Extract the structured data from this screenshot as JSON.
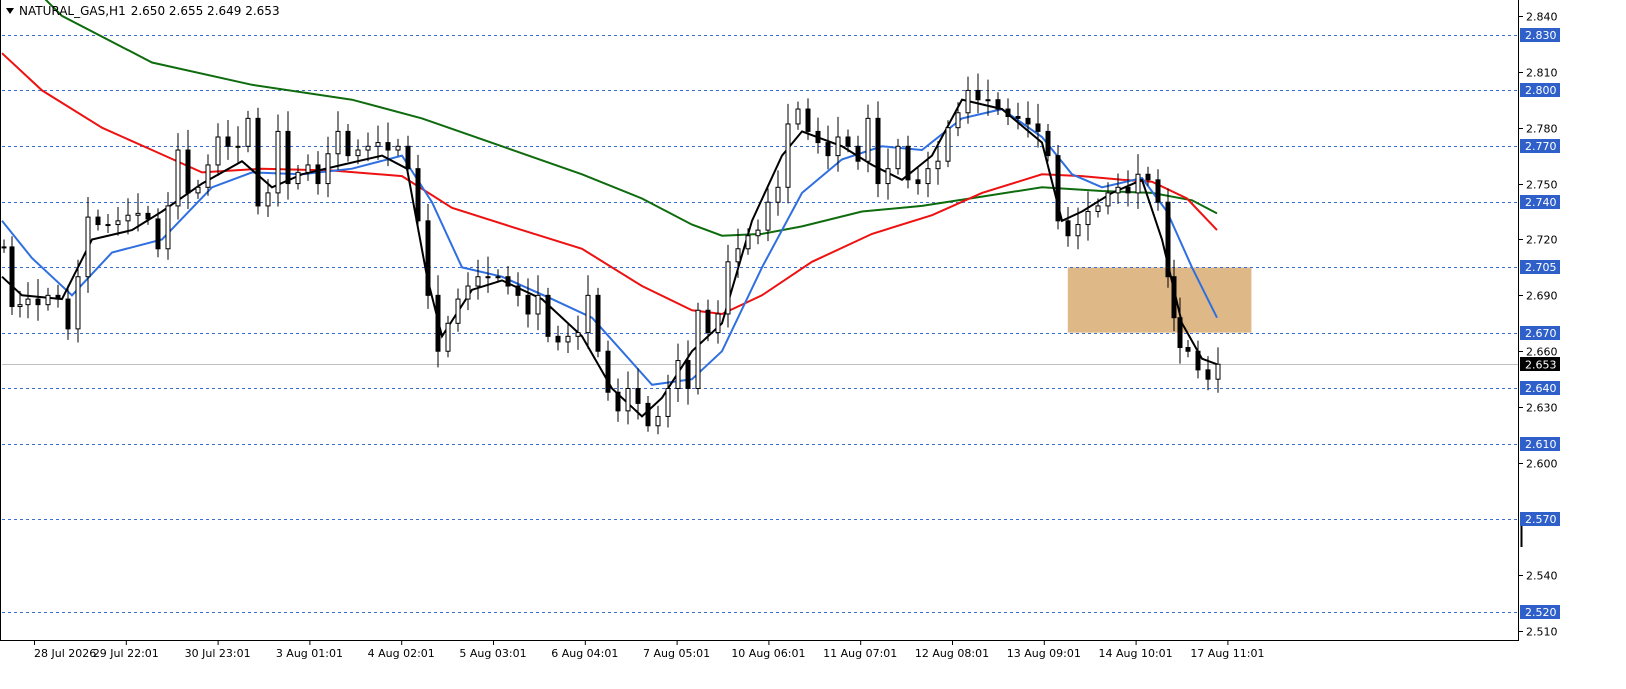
{
  "header": {
    "symbol": "NATURAL_GAS,H1",
    "ohlc": "2.650 2.655 2.649 2.653"
  },
  "colors": {
    "level_line": "#3a6fd1",
    "level_label_bg": "#2f60c9",
    "bull": "#000000",
    "ema_fast": "#000000",
    "ema_mid": "#2f6fe0",
    "ema_slow": "#ee1111",
    "ema_long": "#0e6b0e",
    "zone_fill": "#deb887",
    "current_bg": "#000000",
    "current_line": "#c0c0c0"
  },
  "chart_data": {
    "type": "candlestick",
    "ylim": [
      2.505,
      2.848
    ],
    "y_ticks": [
      "2.510",
      "2.540",
      "2.600",
      "2.630",
      "2.660",
      "2.690",
      "2.720",
      "2.750",
      "2.780",
      "2.810",
      "2.840"
    ],
    "horizontal_levels": [
      "2.520",
      "2.570",
      "2.610",
      "2.640",
      "2.670",
      "2.705",
      "2.740",
      "2.770",
      "2.800",
      "2.830"
    ],
    "current_price": "2.653",
    "x_labels": [
      "28 Jul 2026",
      "29 Jul 22:01",
      "30 Jul 23:01",
      "3 Aug 01:01",
      "4 Aug 02:01",
      "5 Aug 03:01",
      "6 Aug 04:01",
      "7 Aug 05:01",
      "10 Aug 06:01",
      "11 Aug 07:01",
      "12 Aug 08:01",
      "13 Aug 09:01",
      "14 Aug 10:01",
      "17 Aug 11:01"
    ],
    "zone": {
      "top": 2.705,
      "bottom": 2.67,
      "start_label": "13 Aug 09:01",
      "end_label": "17 Aug 11:01"
    },
    "price_path": [
      [
        0,
        2.716
      ],
      [
        8,
        2.684
      ],
      [
        16,
        2.685
      ],
      [
        24,
        2.688
      ],
      [
        34,
        2.685
      ],
      [
        44,
        2.69
      ],
      [
        54,
        2.688
      ],
      [
        64,
        2.672
      ],
      [
        74,
        2.7
      ],
      [
        84,
        2.732
      ],
      [
        94,
        2.728
      ],
      [
        104,
        2.728
      ],
      [
        114,
        2.73
      ],
      [
        124,
        2.733
      ],
      [
        134,
        2.734
      ],
      [
        144,
        2.731
      ],
      [
        154,
        2.715
      ],
      [
        164,
        2.738
      ],
      [
        174,
        2.768
      ],
      [
        184,
        2.745
      ],
      [
        194,
        2.748
      ],
      [
        204,
        2.76
      ],
      [
        214,
        2.775
      ],
      [
        224,
        2.77
      ],
      [
        234,
        2.77
      ],
      [
        244,
        2.785
      ],
      [
        254,
        2.738
      ],
      [
        264,
        2.745
      ],
      [
        274,
        2.778
      ],
      [
        284,
        2.75
      ],
      [
        294,
        2.756
      ],
      [
        304,
        2.76
      ],
      [
        314,
        2.75
      ],
      [
        324,
        2.766
      ],
      [
        334,
        2.778
      ],
      [
        344,
        2.765
      ],
      [
        354,
        2.768
      ],
      [
        364,
        2.77
      ],
      [
        374,
        2.772
      ],
      [
        384,
        2.768
      ],
      [
        394,
        2.77
      ],
      [
        404,
        2.758
      ],
      [
        414,
        2.73
      ],
      [
        424,
        2.69
      ],
      [
        434,
        2.66
      ],
      [
        444,
        2.675
      ],
      [
        454,
        2.688
      ],
      [
        464,
        2.695
      ],
      [
        474,
        2.7
      ],
      [
        484,
        2.7
      ],
      [
        494,
        2.7
      ],
      [
        504,
        2.695
      ],
      [
        514,
        2.69
      ],
      [
        524,
        2.68
      ],
      [
        534,
        2.69
      ],
      [
        544,
        2.668
      ],
      [
        554,
        2.665
      ],
      [
        564,
        2.668
      ],
      [
        574,
        2.67
      ],
      [
        584,
        2.69
      ],
      [
        594,
        2.66
      ],
      [
        604,
        2.638
      ],
      [
        614,
        2.628
      ],
      [
        624,
        2.64
      ],
      [
        634,
        2.632
      ],
      [
        644,
        2.62
      ],
      [
        654,
        2.625
      ],
      [
        664,
        2.64
      ],
      [
        674,
        2.655
      ],
      [
        684,
        2.64
      ],
      [
        694,
        2.682
      ],
      [
        704,
        2.67
      ],
      [
        714,
        2.68
      ],
      [
        724,
        2.708
      ],
      [
        734,
        2.715
      ],
      [
        744,
        2.722
      ],
      [
        754,
        2.725
      ],
      [
        764,
        2.74
      ],
      [
        774,
        2.748
      ],
      [
        784,
        2.782
      ],
      [
        794,
        2.79
      ],
      [
        804,
        2.778
      ],
      [
        814,
        2.772
      ],
      [
        824,
        2.765
      ],
      [
        834,
        2.775
      ],
      [
        844,
        2.77
      ],
      [
        854,
        2.762
      ],
      [
        864,
        2.785
      ],
      [
        874,
        2.75
      ],
      [
        884,
        2.758
      ],
      [
        894,
        2.77
      ],
      [
        904,
        2.752
      ],
      [
        914,
        2.75
      ],
      [
        924,
        2.758
      ],
      [
        934,
        2.762
      ],
      [
        944,
        2.78
      ],
      [
        954,
        2.788
      ],
      [
        964,
        2.8
      ],
      [
        974,
        2.795
      ],
      [
        984,
        2.795
      ],
      [
        994,
        2.79
      ],
      [
        1004,
        2.786
      ],
      [
        1014,
        2.785
      ],
      [
        1024,
        2.782
      ],
      [
        1034,
        2.778
      ],
      [
        1044,
        2.765
      ],
      [
        1054,
        2.73
      ],
      [
        1064,
        2.722
      ],
      [
        1074,
        2.728
      ],
      [
        1084,
        2.735
      ],
      [
        1094,
        2.738
      ],
      [
        1104,
        2.745
      ],
      [
        1114,
        2.748
      ],
      [
        1124,
        2.745
      ],
      [
        1134,
        2.755
      ],
      [
        1144,
        2.752
      ],
      [
        1154,
        2.74
      ],
      [
        1164,
        2.7
      ],
      [
        1170,
        2.678
      ],
      [
        1176,
        2.662
      ],
      [
        1184,
        2.66
      ],
      [
        1194,
        2.65
      ],
      [
        1204,
        2.645
      ],
      [
        1214,
        2.653
      ]
    ],
    "series": [
      {
        "color_key": "ema_long",
        "points": [
          [
            0,
            2.872
          ],
          [
            60,
            2.84
          ],
          [
            150,
            2.815
          ],
          [
            250,
            2.803
          ],
          [
            350,
            2.795
          ],
          [
            420,
            2.785
          ],
          [
            500,
            2.77
          ],
          [
            580,
            2.755
          ],
          [
            640,
            2.742
          ],
          [
            690,
            2.728
          ],
          [
            720,
            2.722
          ],
          [
            760,
            2.723
          ],
          [
            800,
            2.727
          ],
          [
            860,
            2.735
          ],
          [
            920,
            2.738
          ],
          [
            980,
            2.743
          ],
          [
            1040,
            2.748
          ],
          [
            1100,
            2.746
          ],
          [
            1150,
            2.745
          ],
          [
            1190,
            2.741
          ],
          [
            1215,
            2.734
          ]
        ]
      },
      {
        "color_key": "ema_slow",
        "points": [
          [
            0,
            2.82
          ],
          [
            40,
            2.8
          ],
          [
            100,
            2.78
          ],
          [
            150,
            2.768
          ],
          [
            200,
            2.756
          ],
          [
            260,
            2.758
          ],
          [
            330,
            2.757
          ],
          [
            400,
            2.754
          ],
          [
            450,
            2.737
          ],
          [
            520,
            2.725
          ],
          [
            580,
            2.715
          ],
          [
            640,
            2.695
          ],
          [
            690,
            2.682
          ],
          [
            720,
            2.68
          ],
          [
            760,
            2.69
          ],
          [
            810,
            2.708
          ],
          [
            870,
            2.723
          ],
          [
            930,
            2.733
          ],
          [
            980,
            2.745
          ],
          [
            1040,
            2.755
          ],
          [
            1080,
            2.754
          ],
          [
            1120,
            2.752
          ],
          [
            1150,
            2.751
          ],
          [
            1185,
            2.742
          ],
          [
            1215,
            2.725
          ]
        ]
      },
      {
        "color_key": "ema_mid",
        "points": [
          [
            0,
            2.73
          ],
          [
            30,
            2.71
          ],
          [
            70,
            2.69
          ],
          [
            110,
            2.713
          ],
          [
            160,
            2.72
          ],
          [
            210,
            2.748
          ],
          [
            250,
            2.756
          ],
          [
            300,
            2.755
          ],
          [
            350,
            2.758
          ],
          [
            400,
            2.765
          ],
          [
            430,
            2.74
          ],
          [
            460,
            2.705
          ],
          [
            500,
            2.7
          ],
          [
            550,
            2.688
          ],
          [
            590,
            2.678
          ],
          [
            620,
            2.66
          ],
          [
            650,
            2.642
          ],
          [
            690,
            2.645
          ],
          [
            720,
            2.66
          ],
          [
            760,
            2.705
          ],
          [
            800,
            2.745
          ],
          [
            840,
            2.763
          ],
          [
            880,
            2.77
          ],
          [
            920,
            2.768
          ],
          [
            960,
            2.785
          ],
          [
            1000,
            2.79
          ],
          [
            1040,
            2.775
          ],
          [
            1070,
            2.755
          ],
          [
            1100,
            2.748
          ],
          [
            1140,
            2.753
          ],
          [
            1165,
            2.735
          ],
          [
            1190,
            2.705
          ],
          [
            1215,
            2.678
          ]
        ]
      },
      {
        "color_key": "ema_fast",
        "points": [
          [
            0,
            2.7
          ],
          [
            20,
            2.69
          ],
          [
            60,
            2.688
          ],
          [
            90,
            2.72
          ],
          [
            130,
            2.725
          ],
          [
            160,
            2.735
          ],
          [
            200,
            2.75
          ],
          [
            240,
            2.762
          ],
          [
            270,
            2.748
          ],
          [
            300,
            2.755
          ],
          [
            340,
            2.76
          ],
          [
            380,
            2.765
          ],
          [
            405,
            2.758
          ],
          [
            425,
            2.7
          ],
          [
            440,
            2.668
          ],
          [
            470,
            2.693
          ],
          [
            500,
            2.698
          ],
          [
            540,
            2.688
          ],
          [
            580,
            2.668
          ],
          [
            610,
            2.64
          ],
          [
            640,
            2.625
          ],
          [
            660,
            2.635
          ],
          [
            690,
            2.66
          ],
          [
            720,
            2.675
          ],
          [
            750,
            2.73
          ],
          [
            780,
            2.765
          ],
          [
            800,
            2.778
          ],
          [
            840,
            2.77
          ],
          [
            870,
            2.76
          ],
          [
            900,
            2.752
          ],
          [
            930,
            2.765
          ],
          [
            960,
            2.795
          ],
          [
            1000,
            2.79
          ],
          [
            1040,
            2.772
          ],
          [
            1060,
            2.73
          ],
          [
            1080,
            2.735
          ],
          [
            1110,
            2.745
          ],
          [
            1140,
            2.752
          ],
          [
            1160,
            2.72
          ],
          [
            1180,
            2.675
          ],
          [
            1200,
            2.656
          ],
          [
            1215,
            2.653
          ]
        ]
      }
    ]
  }
}
